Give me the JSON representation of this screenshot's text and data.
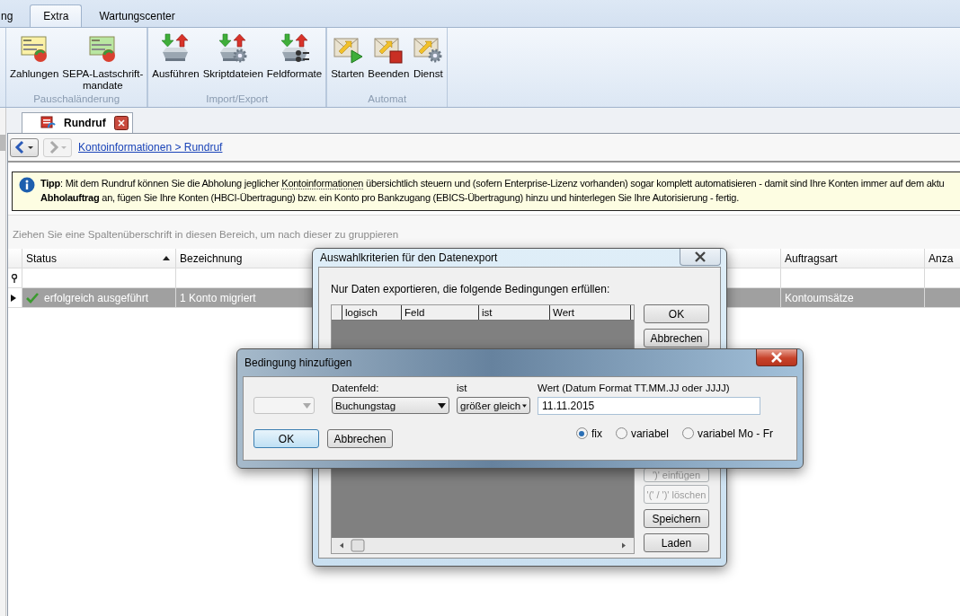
{
  "ribbon_tabs": [
    {
      "label": "ng",
      "selected": false
    },
    {
      "label": "Extra",
      "selected": true
    },
    {
      "label": "Wartungscenter",
      "selected": false
    }
  ],
  "ribbon_groups": [
    {
      "label": "Pauschaländerung",
      "buttons": [
        {
          "label": "Zahlungen",
          "kind": "form-yellow"
        },
        {
          "label": "SEPA-Lastschrift-\nmandate",
          "kind": "form-green"
        }
      ]
    },
    {
      "label": "Import/Export",
      "buttons": [
        {
          "label": "Ausführen",
          "kind": "tray"
        },
        {
          "label": "Skriptdateien",
          "kind": "tray-gear"
        },
        {
          "label": "Feldformate",
          "kind": "tray-list"
        }
      ]
    },
    {
      "label": "Automat",
      "buttons": [
        {
          "label": "Starten",
          "kind": "mail-play"
        },
        {
          "label": "Beenden",
          "kind": "mail-stop"
        },
        {
          "label": "Dienst",
          "kind": "mail-gear"
        }
      ]
    }
  ],
  "document_tab": {
    "title": "Rundruf"
  },
  "navigation": {
    "back_enabled": true,
    "forward_enabled": false,
    "breadcrumb": "Kontoinformationen > Rundruf"
  },
  "tip": {
    "lines": [
      [
        {
          "kind": "bold",
          "text": "Tipp"
        },
        {
          "kind": "plain",
          "text": ": Mit dem Rundruf können Sie die Abholung jeglicher "
        },
        {
          "kind": "term",
          "text": "Kontoinformationen"
        },
        {
          "kind": "plain",
          "text": " übersichtlich steuern und (sofern Enterprise-Lizenz vorhanden) sogar komplett automatisieren - damit sind Ihre Konten immer auf dem aktu"
        }
      ],
      [
        {
          "kind": "bold",
          "text": "Abholauftrag"
        },
        {
          "kind": "plain",
          "text": " an, fügen Sie Ihre Konten (HBCI-Übertragung) bzw. ein Konto pro Bankzugang (EBICS-Übertragung) hinzu und hinterlegen Sie Ihre Autorisierung - fertig."
        }
      ]
    ]
  },
  "group_hint": "Ziehen Sie eine Spaltenüberschrift in diesen Bereich, um nach dieser zu gruppieren",
  "grid": {
    "columns": [
      {
        "label": "Status",
        "sorted": true
      },
      {
        "label": "Bezeichnung"
      },
      {
        "label": "Auftragsart"
      },
      {
        "label": "Anza"
      }
    ],
    "rows": [
      {
        "selected": true,
        "succeeded": true,
        "cells": [
          "erfolgreich ausgeführt",
          "1 Konto migriert",
          "Kontoumsätze"
        ]
      }
    ]
  },
  "export_dialog": {
    "title": "Auswahlkriterien für den Datenexport",
    "instruction": "Nur Daten exportieren, die folgende Bedingungen erfüllen:",
    "columns": [
      "logisch",
      "Feld",
      "ist",
      "Wert"
    ],
    "buttons": [
      {
        "label": "OK",
        "disabled": false
      },
      {
        "label": "Abbrechen",
        "disabled": false
      },
      {
        "label": "')' einfügen",
        "disabled": true
      },
      {
        "label": "'(' / ')' löschen",
        "disabled": true
      },
      {
        "label": "Speichern",
        "disabled": false
      },
      {
        "label": "Laden",
        "disabled": false
      }
    ]
  },
  "condition_dialog": {
    "title": "Bedingung hinzufügen",
    "fields": [
      {
        "kind": "combo",
        "disabled": true
      },
      {
        "kind": "combo",
        "label": "Datenfeld:",
        "value": "Buchungstag",
        "disabled": false
      },
      {
        "kind": "combo",
        "label": "ist",
        "value": "größer gleich",
        "disabled": false
      },
      {
        "kind": "text",
        "label": "Wert (Datum Format TT.MM.JJ oder JJJJ)",
        "value": "11.11.2015",
        "disabled": false
      }
    ],
    "radios": [
      {
        "label": "fix",
        "selected": true
      },
      {
        "label": "variabel",
        "selected": false
      },
      {
        "label": "variabel Mo - Fr",
        "selected": false
      }
    ],
    "buttons": [
      {
        "label": "OK",
        "default": true
      },
      {
        "label": "Abbrechen",
        "default": false
      }
    ]
  }
}
